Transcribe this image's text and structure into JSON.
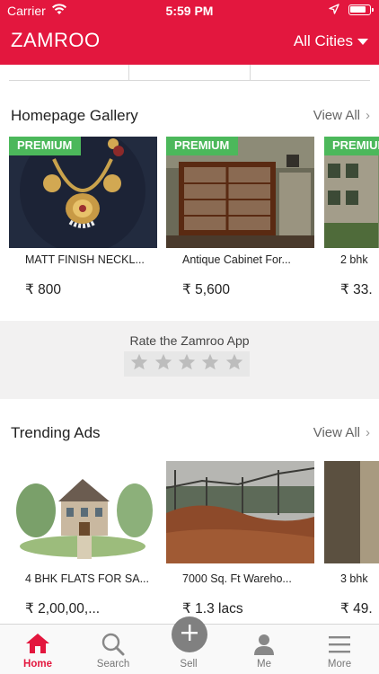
{
  "status_bar": {
    "carrier": "Carrier",
    "time": "5:59 PM"
  },
  "header": {
    "brand": "ZAMROO",
    "city_selector": "All Cities"
  },
  "homepage_gallery": {
    "title": "Homepage Gallery",
    "view_all": "View All",
    "items": [
      {
        "badge": "PREMIUM",
        "title": "MATT FINISH NECKL...",
        "price": "₹ 800"
      },
      {
        "badge": "PREMIUM",
        "title": "Antique Cabinet For...",
        "price": "₹ 5,600"
      },
      {
        "badge": "PREMIUM",
        "title": "2 bhk",
        "price": "₹ 33."
      }
    ]
  },
  "rate_app": {
    "label": "Rate the Zamroo App",
    "stars_total": 5,
    "stars_selected": 0
  },
  "trending_ads": {
    "title": "Trending Ads",
    "view_all": "View All",
    "items": [
      {
        "title": "4 BHK FLATS FOR SA...",
        "price": "₹ 2,00,00,..."
      },
      {
        "title": "7000 Sq. Ft Wareho...",
        "price": "₹ 1.3 lacs"
      },
      {
        "title": "3 bhk",
        "price": "₹ 49."
      }
    ]
  },
  "tab_bar": {
    "items": [
      {
        "label": "Home",
        "icon": "home-icon",
        "active": true
      },
      {
        "label": "Search",
        "icon": "search-icon",
        "active": false
      },
      {
        "label": "Sell",
        "icon": "plus-icon",
        "active": false
      },
      {
        "label": "Me",
        "icon": "user-icon",
        "active": false
      },
      {
        "label": "More",
        "icon": "menu-icon",
        "active": false
      }
    ]
  },
  "colors": {
    "brand_red": "#e3173e",
    "premium_green": "#4cb85b"
  }
}
